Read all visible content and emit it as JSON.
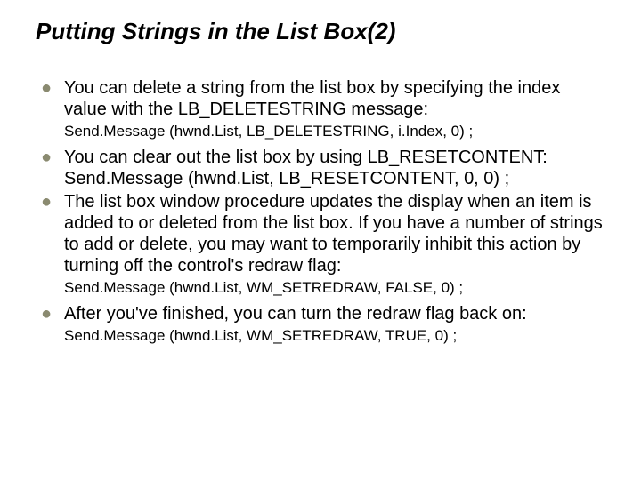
{
  "title": "Putting Strings in the List Box(2)",
  "items": {
    "b1": "You can delete a string from the list box by specifying the index value with the LB_DELETESTRING message:",
    "c1": "Send.Message (hwnd.List, LB_DELETESTRING, i.Index, 0) ;",
    "b2a": "You can clear out the list box by using LB_RESETCONTENT:",
    "b2b": "Send.Message (hwnd.List, LB_RESETCONTENT, 0, 0) ;",
    "b3": "The list box window procedure updates the display when an item is added to or deleted from the list box. If you have a number of strings to add or delete, you may want to temporarily inhibit this action by turning off the control's redraw flag:",
    "c3": "Send.Message (hwnd.List, WM_SETREDRAW, FALSE, 0) ;",
    "b4": "After you've finished, you can turn the redraw flag back on:",
    "c4": "Send.Message (hwnd.List, WM_SETREDRAW, TRUE, 0) ;"
  }
}
